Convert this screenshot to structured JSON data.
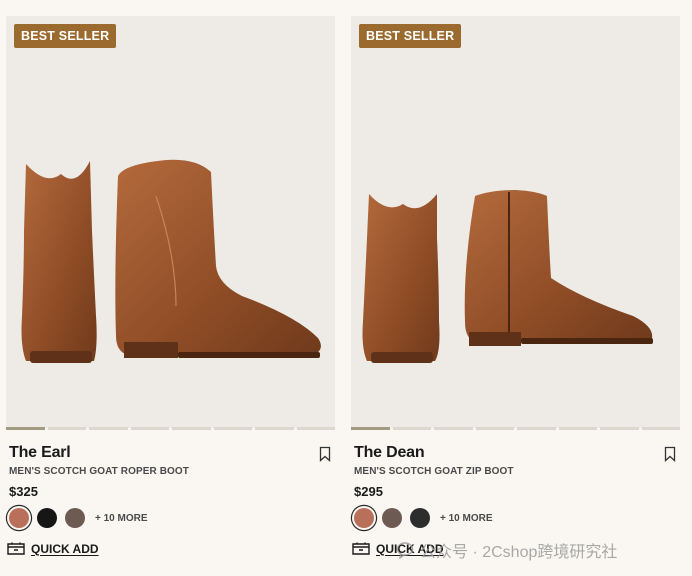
{
  "products": [
    {
      "badge": "BEST SELLER",
      "title": "The Earl",
      "subtitle": "MEN'S SCOTCH GOAT ROPER BOOT",
      "price": "$325",
      "more_colors": "+ 10 MORE",
      "quick_add": "QUICK ADD",
      "swatches": [
        "#b8705a",
        "#161616",
        "#6d5a52"
      ],
      "image_dots": 8,
      "active_dot": 0
    },
    {
      "badge": "BEST SELLER",
      "title": "The Dean",
      "subtitle": "MEN'S SCOTCH GOAT ZIP BOOT",
      "price": "$295",
      "more_colors": "+ 10 MORE",
      "quick_add": "QUICK ADD",
      "swatches": [
        "#b8705a",
        "#6d5a52",
        "#2d2d2d"
      ],
      "image_dots": 8,
      "active_dot": 0
    }
  ],
  "watermark": "公众号 · 2Cshop跨境研究社",
  "colors": {
    "badge": "#9b6a2e",
    "leather": "#9a5530",
    "image_bg": "#eeebe6"
  }
}
